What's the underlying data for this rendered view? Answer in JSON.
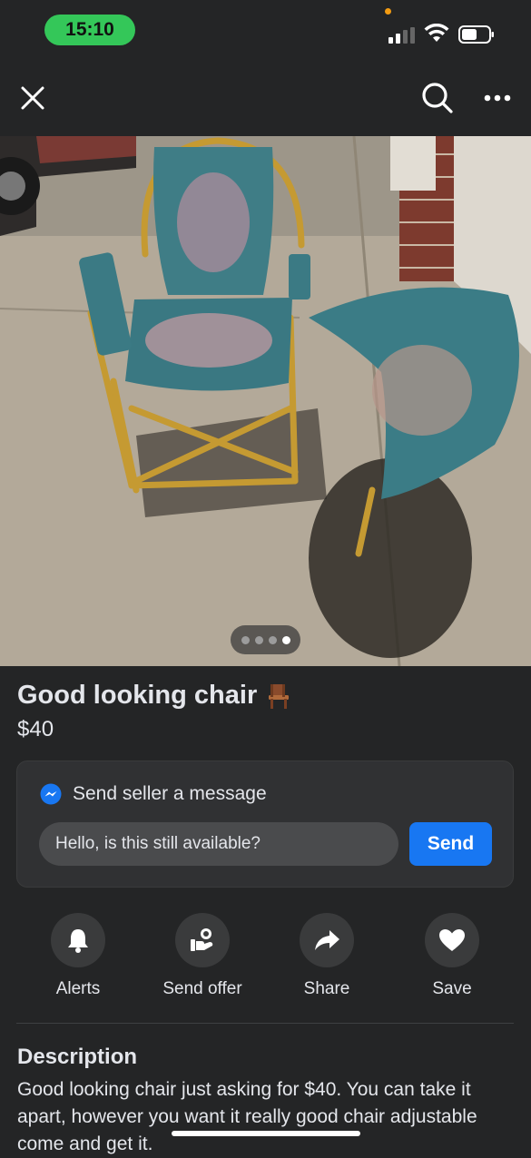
{
  "status_bar": {
    "time": "15:10"
  },
  "nav": {
    "close_icon": "close-icon",
    "search_icon": "search-icon",
    "more_icon": "more-icon"
  },
  "listing": {
    "title": "Good looking chair",
    "title_emoji": "chair-icon",
    "price": "$40",
    "image_pager": {
      "count": 4,
      "active_index": 3
    }
  },
  "message": {
    "header": "Send seller a message",
    "input_value": "Hello, is this still available?",
    "send_label": "Send"
  },
  "actions": [
    {
      "label": "Alerts",
      "icon": "bell-icon"
    },
    {
      "label": "Send offer",
      "icon": "offer-icon"
    },
    {
      "label": "Share",
      "icon": "share-icon"
    },
    {
      "label": "Save",
      "icon": "heart-icon"
    }
  ],
  "description": {
    "heading": "Description",
    "text": "Good looking chair just asking for $40. You can take it apart, however you want it really good chair adjustable come and get it."
  },
  "colors": {
    "background": "#242526",
    "accent": "#1877f2",
    "status_pill": "#34c759"
  }
}
